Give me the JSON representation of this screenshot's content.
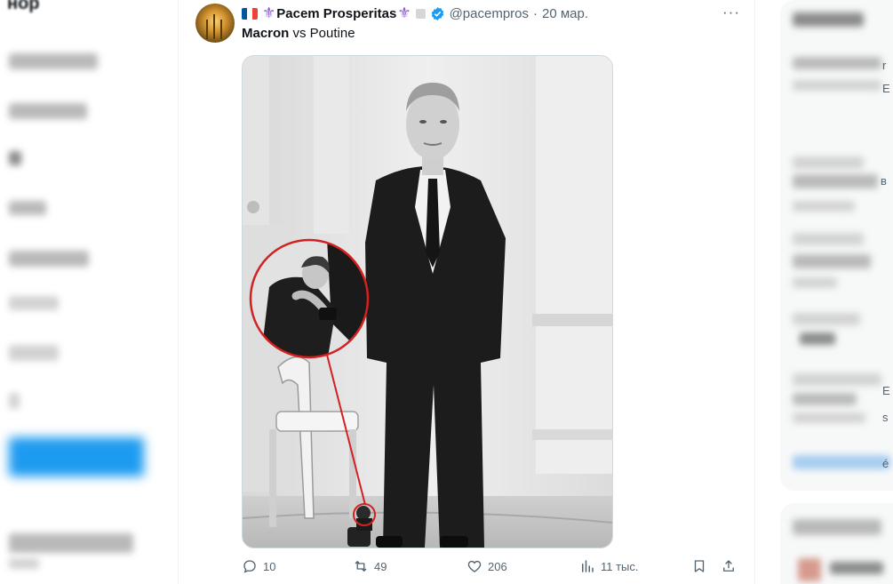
{
  "left_sidebar": {
    "clipped_heading": "нор"
  },
  "tweet": {
    "author": {
      "flag": "French flag",
      "name": "Pacem Prosperitas",
      "handle": "@pacempros",
      "date": "20 мар.",
      "separator": "·",
      "verified": true
    },
    "more_label": "···",
    "text": {
      "bold": "Macron",
      "rest": " vs Poutine"
    },
    "media": {
      "annotation": "red circle zoom highlight",
      "mode": "black-and-white photo"
    },
    "actions": {
      "replies": "10",
      "reposts": "49",
      "likes": "206",
      "views": "11 тыс."
    }
  },
  "right_sidebar": {
    "edge_glyphs": [
      "r",
      "E",
      "в",
      "s",
      "E",
      "é"
    ]
  },
  "icons": {
    "reply": "reply-icon",
    "repost": "repost-icon",
    "like": "heart-icon",
    "views": "views-icon",
    "bookmark": "bookmark-icon",
    "share": "share-icon",
    "more": "more-icon",
    "verified": "verified-badge-icon"
  },
  "colors": {
    "text_primary": "#0f1419",
    "text_secondary": "#536471",
    "accent_blue": "#1d9bf0",
    "highlight_red": "#d32020",
    "fleur_purple": "#8a5fc7"
  }
}
